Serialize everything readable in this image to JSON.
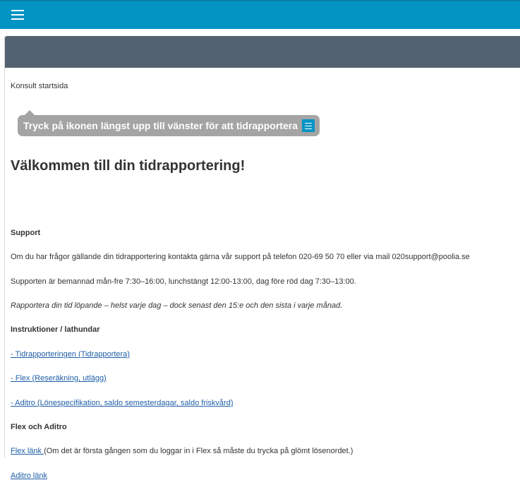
{
  "header": {
    "menu_icon": "hamburger-menu-icon",
    "accent_color": "#0394c4",
    "panel_header_color": "#536271"
  },
  "breadcrumb": "Konsult startsida",
  "tip": {
    "text": "Tryck på ikonen längst upp till vänster för att tidrapportera",
    "icon": "menu-icon"
  },
  "content": {
    "title": "Välkommen till din tidrapportering!",
    "support_heading": "Support",
    "support_text": "Om du har frågor gällande din tidrapportering kontakta gärna vår support på telefon 020-69 50 70 eller via mail 020support@poolia.se",
    "hours_text": "Supporten är bemannad mån-fre 7:30–16:00, lunchstängt 12:00-13:00, dag före röd dag 7:30–13:00.",
    "reminder_text": "Rapportera din tid löpande – helst varje dag – dock senast den 15:e och den sista i varje månad.",
    "instructions_heading": "Instruktioner / lathundar",
    "links": [
      "- Tidrapporteringen (Tidrapportera)",
      "- Flex (Reseräkning, utlägg)",
      "- Aditro (Lönespecifikation, saldo semesterdagar, saldo friskvård)"
    ],
    "flex_heading": "Flex och Aditro",
    "flex_link": "Flex länk ",
    "flex_note": "(Om det är första gången som du loggar in i Flex så måste du trycka på glömt lösenordet.)",
    "aditro_link": "Aditro länk"
  }
}
